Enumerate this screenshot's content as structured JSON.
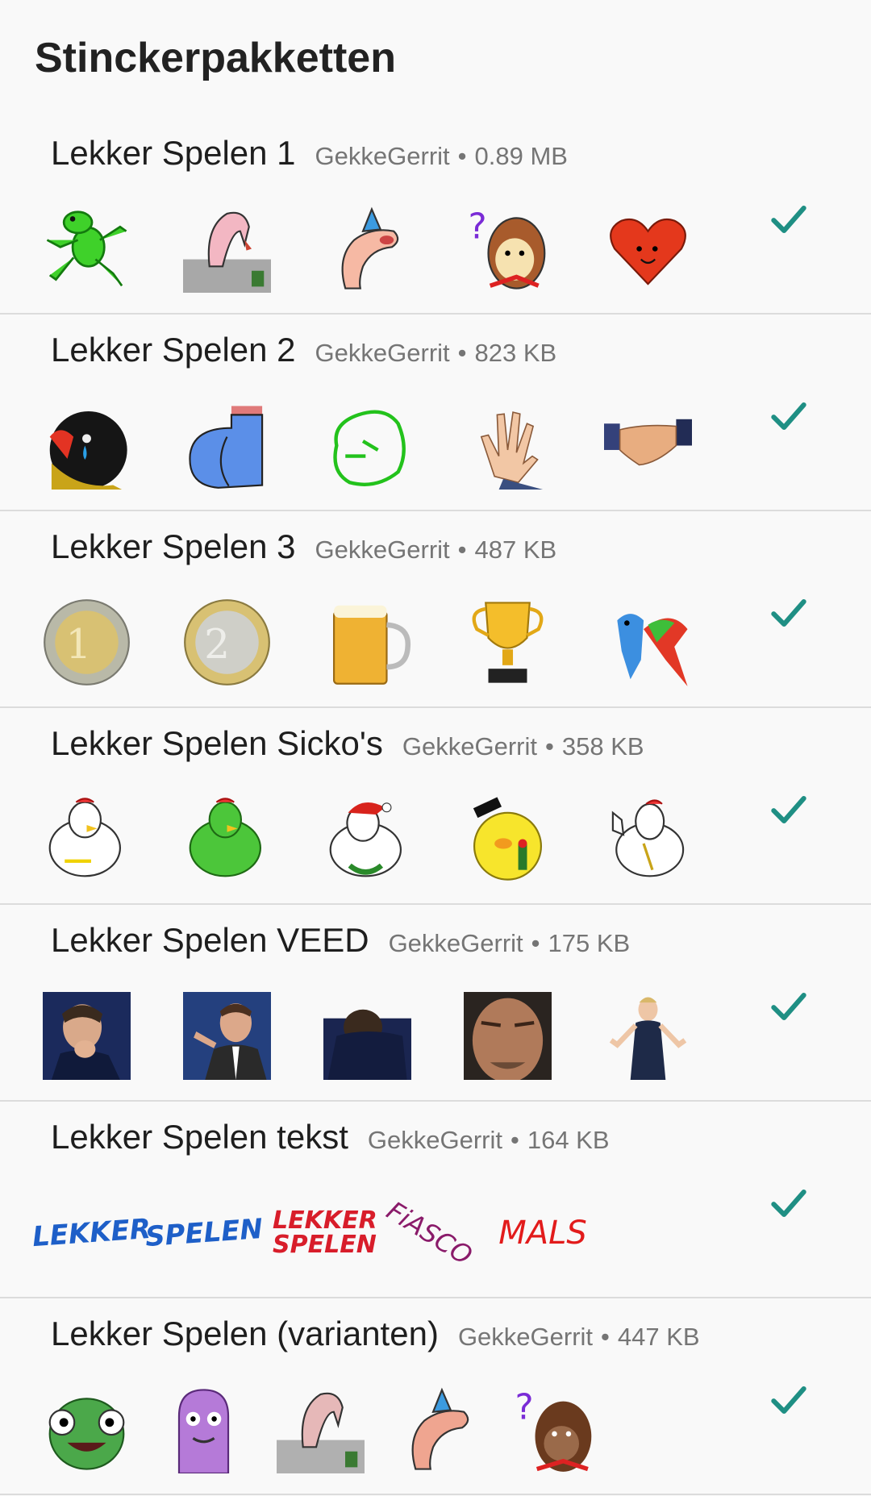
{
  "page": {
    "title": "Stinckerpakketten"
  },
  "colors": {
    "accent": "#1f8f84",
    "divider": "#dcdcdc",
    "meta": "#757575"
  },
  "packs": [
    {
      "name": "Lekker Spelen 1",
      "author": "GekkeGerrit",
      "size": "0.89 MB",
      "added": true,
      "stickers": [
        "frog-sticker",
        "vulture-sticker",
        "party-worm-sticker",
        "confused-monkey-sticker",
        "heart-sticker"
      ]
    },
    {
      "name": "Lekker Spelen 2",
      "author": "GekkeGerrit",
      "size": "823 KB",
      "added": true,
      "stickers": [
        "crying-bird-sticker",
        "blue-bum-sticker",
        "green-face-sticker",
        "waving-hand-sticker",
        "handshake-sticker"
      ]
    },
    {
      "name": "Lekker Spelen 3",
      "author": "GekkeGerrit",
      "size": "487 KB",
      "added": true,
      "stickers": [
        "one-euro-coin-sticker",
        "two-euro-coin-sticker",
        "beer-mug-sticker",
        "trophy-sticker",
        "parrots-sticker"
      ]
    },
    {
      "name": "Lekker Spelen Sicko's",
      "author": "GekkeGerrit",
      "size": "358 KB",
      "added": true,
      "stickers": [
        "white-chicken-sticker",
        "green-chicken-sticker",
        "santa-chicken-sticker",
        "yellow-chick-sticker",
        "thumbs-up-chicken-sticker"
      ]
    },
    {
      "name": "Lekker Spelen VEED",
      "author": "GekkeGerrit",
      "size": "175 KB",
      "added": true,
      "stickers": [
        "man-coughing-sticker",
        "man-pointing-sticker",
        "man-hiding-face-sticker",
        "man-closeup-sticker",
        "woman-shrugging-sticker"
      ]
    },
    {
      "name": "Lekker Spelen tekst",
      "author": "GekkeGerrit",
      "size": "164 KB",
      "added": true,
      "stickers": [
        "lekker-text-sticker",
        "spelen-text-sticker",
        "lekker-spelen-text-sticker",
        "fiasco-text-sticker",
        "mals-text-sticker"
      ],
      "sticker_texts": [
        "LEKKER",
        "SPELEN",
        "LEKKER SPELEN",
        "FiASCO",
        "MALS"
      ]
    },
    {
      "name": "Lekker Spelen (varianten)",
      "author": "GekkeGerrit",
      "size": "447 KB",
      "added": true,
      "stickers": [
        "green-monster-sticker",
        "purple-monster-sticker",
        "vulture-variant-sticker",
        "party-worm-variant-sticker",
        "confused-gorilla-sticker"
      ]
    }
  ]
}
